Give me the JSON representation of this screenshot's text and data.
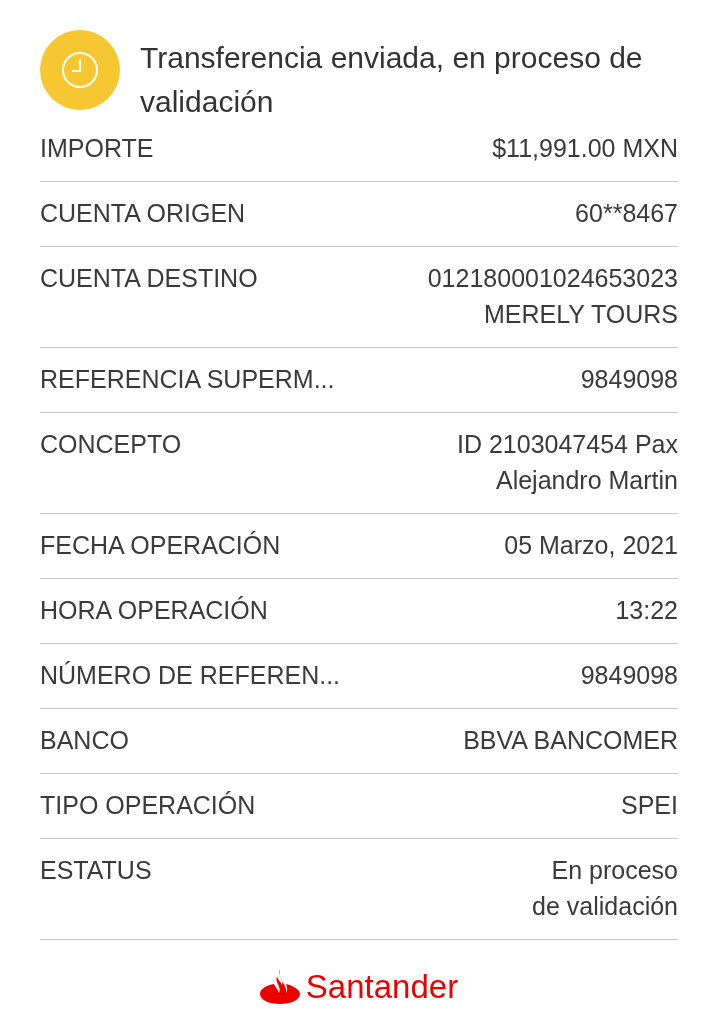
{
  "header": {
    "title": "Transferencia enviada, en proceso de validación"
  },
  "details": [
    {
      "label": "IMPORTE",
      "value": [
        "$11,991.00 MXN"
      ]
    },
    {
      "label": "CUENTA ORIGEN",
      "value": [
        "60**8467"
      ]
    },
    {
      "label": "CUENTA DESTINO",
      "value": [
        "012180001024653023",
        "MERELY TOURS"
      ]
    },
    {
      "label": "REFERENCIA SUPERM...",
      "value": [
        "9849098"
      ]
    },
    {
      "label": "CONCEPTO",
      "value": [
        "ID 2103047454 Pax",
        "Alejandro Martin"
      ]
    },
    {
      "label": "FECHA OPERACIÓN",
      "value": [
        "05 Marzo, 2021"
      ]
    },
    {
      "label": "HORA OPERACIÓN",
      "value": [
        "13:22"
      ]
    },
    {
      "label": "NÚMERO DE REFEREN...",
      "value": [
        "9849098"
      ]
    },
    {
      "label": "BANCO",
      "value": [
        "BBVA BANCOMER"
      ]
    },
    {
      "label": "TIPO OPERACIÓN",
      "value": [
        "SPEI"
      ]
    },
    {
      "label": "ESTATUS",
      "value": [
        "En proceso",
        "de validación"
      ]
    }
  ],
  "footer": {
    "brand": "Santander"
  }
}
